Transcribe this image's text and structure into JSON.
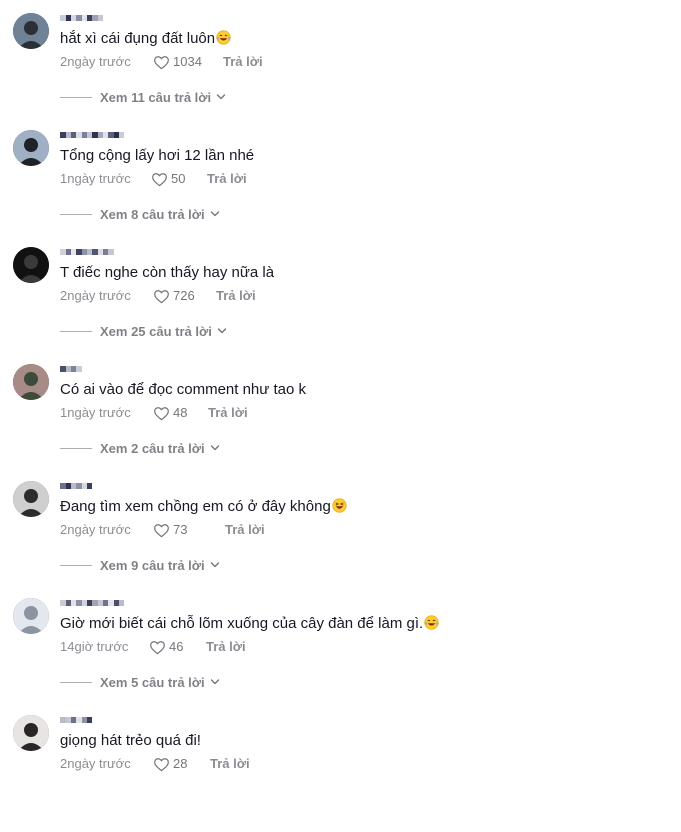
{
  "reply_label": "Trả lời",
  "comments": [
    {
      "text": "hắt xì cái đụng đất luôn",
      "emoji": "laugh-tears-emoji",
      "time": "2ngày trước",
      "likes": "1034",
      "replies": "Xem 11 câu trả lời"
    },
    {
      "text": "Tổng cộng lấy hơi 12 lần nhé",
      "emoji": "",
      "time": "1ngày trước",
      "likes": "50",
      "replies": "Xem 8 câu trả lời"
    },
    {
      "text": "T điếc nghe còn thấy hay nữa là",
      "emoji": "",
      "time": "2ngày trước",
      "likes": "726",
      "replies": "Xem 25 câu trả lời"
    },
    {
      "text": "Có ai vào để đọc comment như tao k",
      "emoji": "",
      "time": "1ngày trước",
      "likes": "48",
      "replies": "Xem 2 câu trả lời"
    },
    {
      "text": "Đang tìm xem chồng em có ở đây không",
      "emoji": "grin-squint-emoji",
      "time": "2ngày trước",
      "likes": "73",
      "replies": "Xem 9 câu trả lời"
    },
    {
      "text": "Giờ mới biết cái chỗ lõm xuống của cây đàn để làm gì.",
      "emoji": "laugh-tears-emoji",
      "time": "14giờ trước",
      "likes": "46",
      "replies": "Xem 5 câu trả lời"
    },
    {
      "text": "giọng hát trẻo quá đi!",
      "emoji": "",
      "time": "2ngày trước",
      "likes": "28",
      "replies": ""
    }
  ],
  "colors": {
    "text": "#161823",
    "secondary": "rgba(22,24,35,0.5)",
    "background": "#ffffff"
  }
}
